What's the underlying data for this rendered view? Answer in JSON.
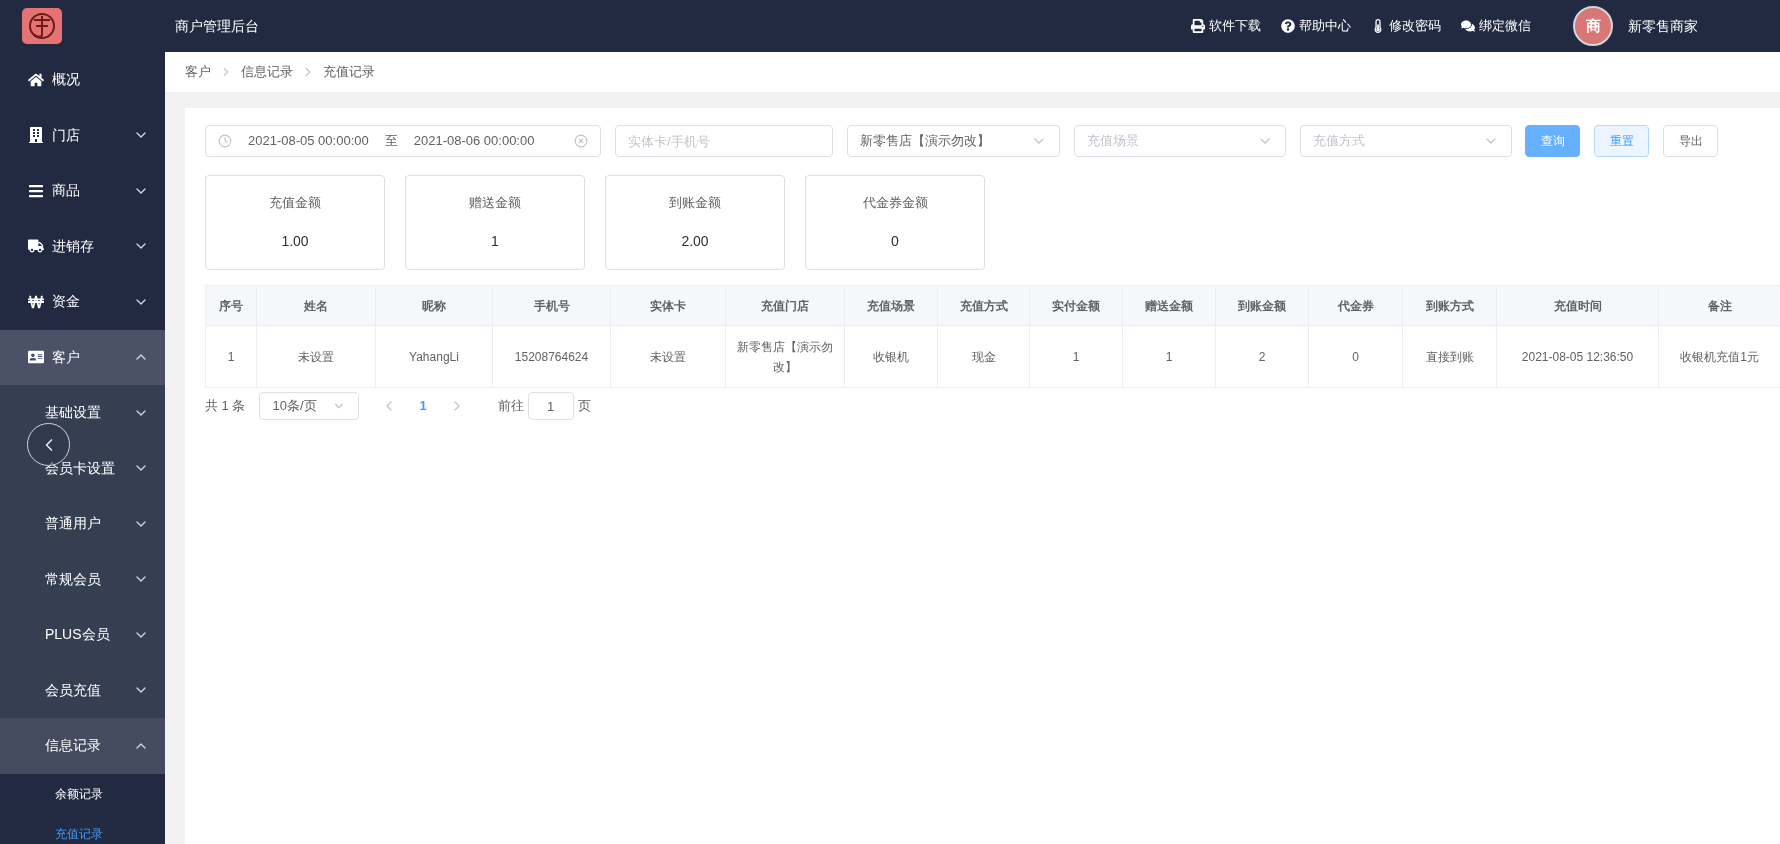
{
  "header": {
    "title": "商户管理后台",
    "links": [
      {
        "label": "软件下载"
      },
      {
        "label": "帮助中心"
      },
      {
        "label": "修改密码"
      },
      {
        "label": "绑定微信"
      }
    ],
    "user": {
      "avatar_text": "商",
      "name": "新零售商家"
    }
  },
  "sidebar": {
    "items": [
      {
        "label": "概况",
        "selected": false
      },
      {
        "label": "门店",
        "expanded": false,
        "selected": false
      },
      {
        "label": "商品",
        "expanded": false,
        "selected": false
      },
      {
        "label": "进销存",
        "expanded": false,
        "selected": false
      },
      {
        "label": "资金",
        "expanded": false,
        "selected": false
      },
      {
        "label": "客户",
        "expanded": true,
        "selected": true,
        "children": [
          {
            "label": "基础设置",
            "expanded": false,
            "selected": false
          },
          {
            "label": "会员卡设置",
            "expanded": false,
            "selected": false
          },
          {
            "label": "普通用户",
            "expanded": false,
            "selected": false
          },
          {
            "label": "常规会员",
            "expanded": false,
            "selected": false
          },
          {
            "label": "PLUS会员",
            "expanded": false,
            "selected": false
          },
          {
            "label": "会员充值",
            "expanded": false,
            "selected": false
          },
          {
            "label": "信息记录",
            "expanded": true,
            "selected": true,
            "children": [
              {
                "label": "余额记录",
                "selected": false
              },
              {
                "label": "充值记录",
                "selected": true
              }
            ]
          }
        ]
      }
    ]
  },
  "breadcrumb": [
    "客户",
    "信息记录",
    "充值记录"
  ],
  "filters": {
    "date_start": "2021-08-05 00:00:00",
    "date_separator": "至",
    "date_end": "2021-08-06 00:00:00",
    "card_placeholder": "实体卡/手机号",
    "store_value": "新零售店【演示勿改】",
    "scene_placeholder": "充值场景",
    "method_placeholder": "充值方式",
    "buttons": [
      {
        "label": "查询",
        "kind": "primary"
      },
      {
        "label": "重置",
        "kind": "light"
      },
      {
        "label": "导出",
        "kind": "default"
      }
    ]
  },
  "summary": [
    {
      "label": "充值金额",
      "value": "1.00"
    },
    {
      "label": "赠送金额",
      "value": "1"
    },
    {
      "label": "到账金额",
      "value": "2.00"
    },
    {
      "label": "代金券金额",
      "value": "0"
    }
  ],
  "table": {
    "columns": [
      "序号",
      "姓名",
      "昵称",
      "手机号",
      "实体卡",
      "充值门店",
      "充值场景",
      "充值方式",
      "实付金额",
      "赠送金额",
      "到账金额",
      "代金券",
      "到账方式",
      "充值时间",
      "备注"
    ],
    "rows": [
      [
        "1",
        "未设置",
        "YahangLi",
        "15208764624",
        "未设置",
        "新零售店【演示勿改】",
        "收银机",
        "现金",
        "1",
        "1",
        "2",
        "0",
        "直接到账",
        "2021-08-05 12:36:50",
        "收银机充值1元"
      ]
    ]
  },
  "pagination": {
    "total": "共 1 条",
    "page_size": "10条/页",
    "pages": [
      {
        "label": "1",
        "selected": true
      }
    ],
    "goto_label": "前往",
    "goto_value": "1",
    "page_suffix": "页"
  }
}
